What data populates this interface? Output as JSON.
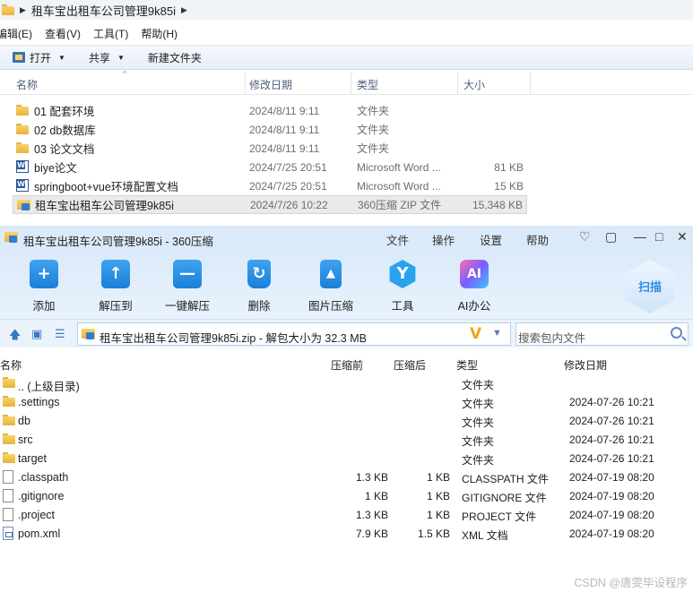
{
  "explorer": {
    "breadcrumb": "租车宝出租车公司管理9k85i",
    "menu": [
      "编辑(E)",
      "查看(V)",
      "工具(T)",
      "帮助(H)"
    ],
    "toolbar": {
      "open": "打开",
      "share": "共享",
      "new_folder": "新建文件夹"
    },
    "columns": {
      "name": "名称",
      "date": "修改日期",
      "type": "类型",
      "size": "大小"
    },
    "rows": [
      {
        "name": "01 配套环境",
        "date": "2024/8/11 9:11",
        "type": "文件夹",
        "size": "",
        "icon": "folder-icon"
      },
      {
        "name": "02 db数据库",
        "date": "2024/8/11 9:11",
        "type": "文件夹",
        "size": "",
        "icon": "folder-icon"
      },
      {
        "name": "03 论文文档",
        "date": "2024/8/11 9:11",
        "type": "文件夹",
        "size": "",
        "icon": "folder-icon"
      },
      {
        "name": "biye论文",
        "date": "2024/7/25 20:51",
        "type": "Microsoft Word ...",
        "size": "81 KB",
        "icon": "word-document-icon"
      },
      {
        "name": "springboot+vue环境配置文档",
        "date": "2024/7/25 20:51",
        "type": "Microsoft Word ...",
        "size": "15 KB",
        "icon": "word-document-icon"
      },
      {
        "name": "租车宝出租车公司管理9k85i",
        "date": "2024/7/26 10:22",
        "type": "360压缩 ZIP 文件",
        "size": "15,348 KB",
        "icon": "zip-archive-icon"
      }
    ]
  },
  "zip": {
    "title": "租车宝出租车公司管理9k85i - 360压缩",
    "menu": [
      "文件",
      "操作",
      "设置",
      "帮助"
    ],
    "tools": [
      {
        "label": "添加",
        "icon": "add-icon"
      },
      {
        "label": "解压到",
        "icon": "extract-to-icon"
      },
      {
        "label": "一键解压",
        "icon": "one-click-extract-icon"
      },
      {
        "label": "删除",
        "icon": "delete-icon"
      },
      {
        "label": "图片压缩",
        "icon": "image-compress-icon"
      },
      {
        "label": "工具",
        "icon": "tools-icon"
      },
      {
        "label": "AI办公",
        "icon": "ai-office-icon"
      }
    ],
    "scan_label": "扫描",
    "address": "租车宝出租车公司管理9k85i.zip - 解包大小为 32.3 MB",
    "search_placeholder": "搜索包内文件",
    "columns": {
      "name": "名称",
      "compressed_before": "压缩前",
      "compressed_after": "压缩后",
      "type": "类型",
      "modified": "修改日期"
    },
    "rows": [
      {
        "name": ".. (上级目录)",
        "before": "",
        "after": "",
        "type": "文件夹",
        "date": "",
        "icon": "folder-icon"
      },
      {
        "name": ".settings",
        "before": "",
        "after": "",
        "type": "文件夹",
        "date": "2024-07-26 10:21",
        "icon": "folder-icon"
      },
      {
        "name": "db",
        "before": "",
        "after": "",
        "type": "文件夹",
        "date": "2024-07-26 10:21",
        "icon": "folder-icon"
      },
      {
        "name": "src",
        "before": "",
        "after": "",
        "type": "文件夹",
        "date": "2024-07-26 10:21",
        "icon": "folder-icon"
      },
      {
        "name": "target",
        "before": "",
        "after": "",
        "type": "文件夹",
        "date": "2024-07-26 10:21",
        "icon": "folder-icon"
      },
      {
        "name": ".classpath",
        "before": "1.3 KB",
        "after": "1 KB",
        "type": "CLASSPATH 文件",
        "date": "2024-07-19 08:20",
        "icon": "file-icon"
      },
      {
        "name": ".gitignore",
        "before": "1 KB",
        "after": "1 KB",
        "type": "GITIGNORE 文件",
        "date": "2024-07-19 08:20",
        "icon": "file-icon"
      },
      {
        "name": ".project",
        "before": "1.3 KB",
        "after": "1 KB",
        "type": "PROJECT 文件",
        "date": "2024-07-19 08:20",
        "icon": "file-icon"
      },
      {
        "name": "pom.xml",
        "before": "7.9 KB",
        "after": "1.5 KB",
        "type": "XML 文档",
        "date": "2024-07-19 08:20",
        "icon": "xml-file-icon"
      }
    ]
  },
  "watermark": "CSDN @唐雯毕设程序"
}
